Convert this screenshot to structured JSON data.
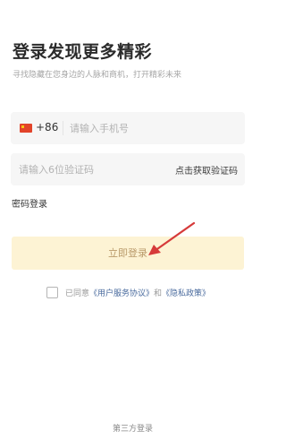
{
  "header": {
    "title": "登录发现更多精彩",
    "subtitle": "寻找隐藏在您身边的人脉和商机，打开精彩未来"
  },
  "phone_field": {
    "country_code": "+86",
    "placeholder": "请输入手机号",
    "value": ""
  },
  "code_field": {
    "placeholder": "请输入6位验证码",
    "value": "",
    "get_code_label": "点击获取验证码"
  },
  "password_login_label": "密码登录",
  "login_button_label": "立即登录",
  "agreement": {
    "checked": false,
    "prefix": "已同意",
    "terms_link": "《用户服务协议》",
    "and": "和",
    "privacy_link": "《隐私政策》"
  },
  "third_party_label": "第三方登录",
  "colors": {
    "login_button_bg": "#fdf3d4",
    "login_button_text": "#b99a6a",
    "link": "#4a6b9e",
    "annotation_arrow": "#d63a3a"
  }
}
